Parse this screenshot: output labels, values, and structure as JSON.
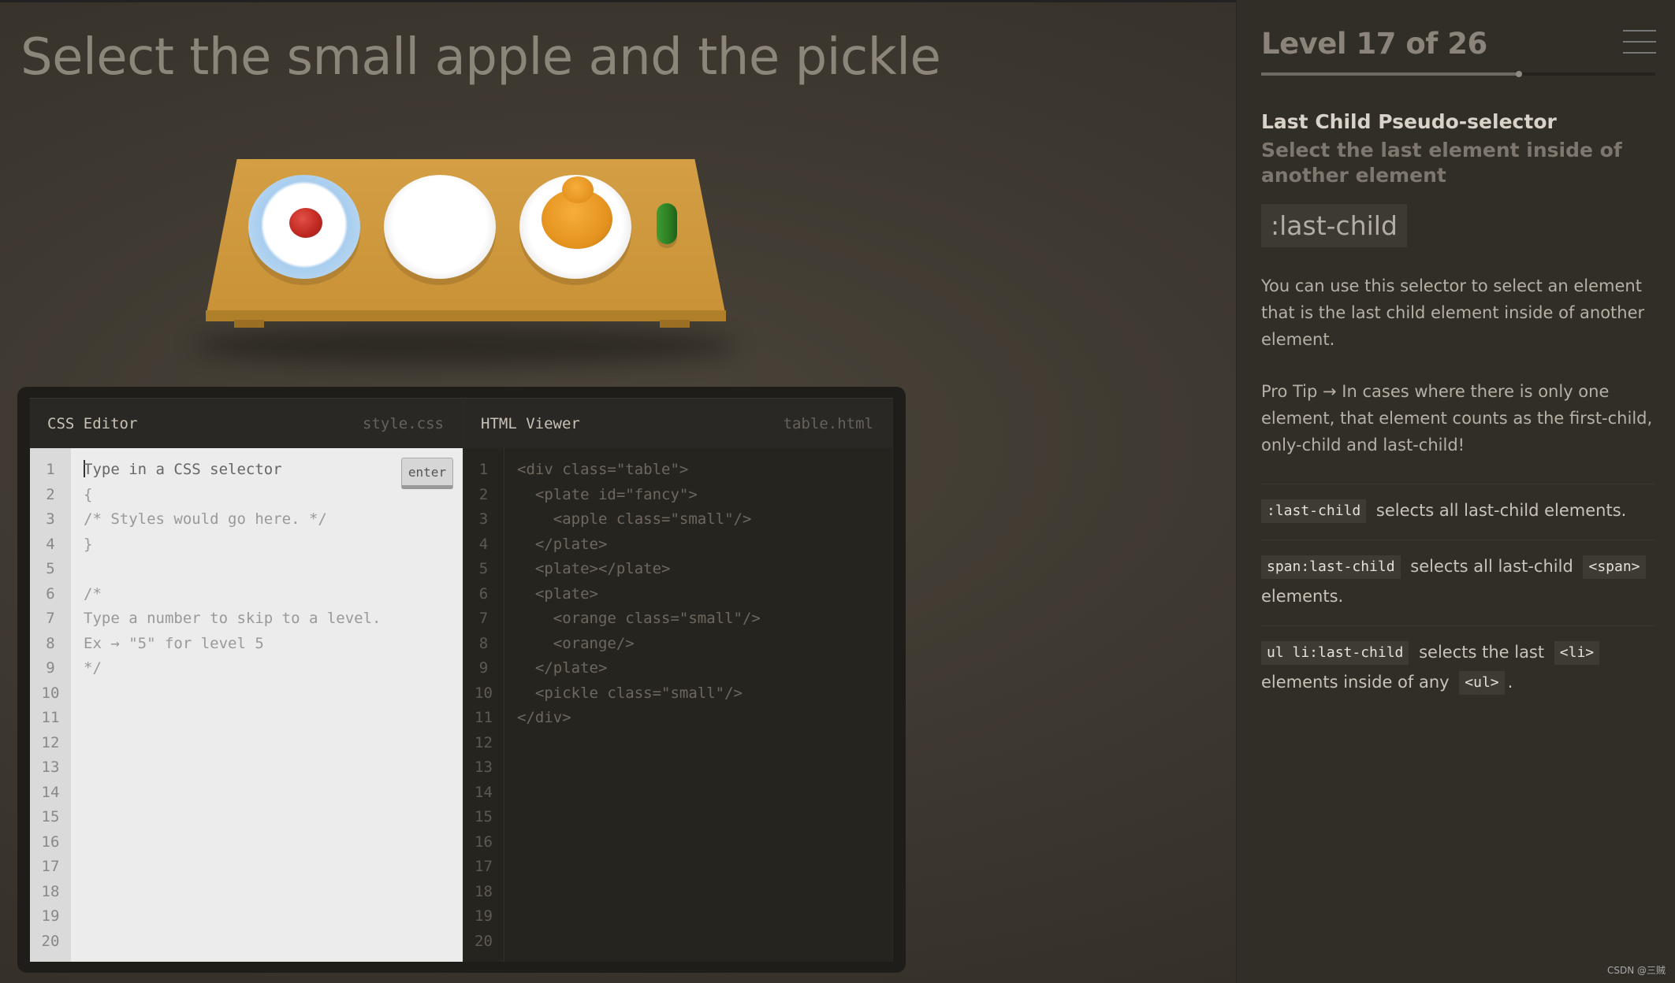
{
  "game": {
    "instruction": "Select the small apple and the pickle",
    "table_items": {
      "plate_fancy": "plate#fancy",
      "apple_small": "apple.small",
      "plate_empty": "plate",
      "plate_orange": "plate",
      "orange_small": "orange.small",
      "orange_big": "orange",
      "pickle_small": "pickle.small"
    }
  },
  "editor": {
    "css_pane": {
      "title": "CSS Editor",
      "filename": "style.css",
      "placeholder": "Type in a CSS selector",
      "enter_label": "enter",
      "lines": [
        "",
        "{",
        "/* Styles would go here. */",
        "}",
        "",
        "/*",
        "Type a number to skip to a level.",
        "Ex → \"5\" for level 5",
        "*/",
        "",
        "",
        "",
        "",
        "",
        "",
        "",
        "",
        "",
        "",
        ""
      ],
      "line_numbers": [
        "1",
        "2",
        "3",
        "4",
        "5",
        "6",
        "7",
        "8",
        "9",
        "10",
        "11",
        "12",
        "13",
        "14",
        "15",
        "16",
        "17",
        "18",
        "19",
        "20"
      ]
    },
    "html_pane": {
      "title": "HTML Viewer",
      "filename": "table.html",
      "lines": [
        "<div class=\"table\">",
        "  <plate id=\"fancy\">",
        "    <apple class=\"small\"/>",
        "  </plate>",
        "  <plate></plate>",
        "  <plate>",
        "    <orange class=\"small\"/>",
        "    <orange/>",
        "  </plate>",
        "  <pickle class=\"small\"/>",
        "</div>",
        "",
        "",
        "",
        "",
        "",
        "",
        "",
        "",
        ""
      ],
      "line_numbers": [
        "1",
        "2",
        "3",
        "4",
        "5",
        "6",
        "7",
        "8",
        "9",
        "10",
        "11",
        "12",
        "13",
        "14",
        "15",
        "16",
        "17",
        "18",
        "19",
        "20"
      ]
    }
  },
  "sidebar": {
    "level_title": "Level 17 of 26",
    "progress": {
      "current": 17,
      "total": 26
    },
    "selector_name": "Last Child Pseudo-selector",
    "selector_title": "Select the last element inside of another element",
    "syntax": ":last-child",
    "description": "You can use this selector to select an element that is the last child element inside of another element.",
    "pro_tip": "Pro Tip → In cases where there is only one element, that element counts as the first-child, only-child and last-child!",
    "examples": [
      {
        "code": ":last-child",
        "text": "selects all last-child elements.",
        "tag": "",
        "after": ""
      },
      {
        "code": "span:last-child",
        "text": "selects all last-child",
        "tag": "<span>",
        "after": "elements."
      },
      {
        "code": "ul li:last-child",
        "text": "selects the last",
        "tag": "<li>",
        "after": "elements inside of any",
        "tag2": "<ul>",
        "after2": "."
      }
    ]
  },
  "watermark": "CSDN @三贼",
  "colors": {
    "background": "#3b362e",
    "sidebar": "#312d27",
    "table": "#cf983f",
    "apple": "#c22a22",
    "orange": "#e4921e",
    "pickle": "#2c7f22"
  },
  "icons": {
    "menu": "hamburger-menu-icon"
  }
}
